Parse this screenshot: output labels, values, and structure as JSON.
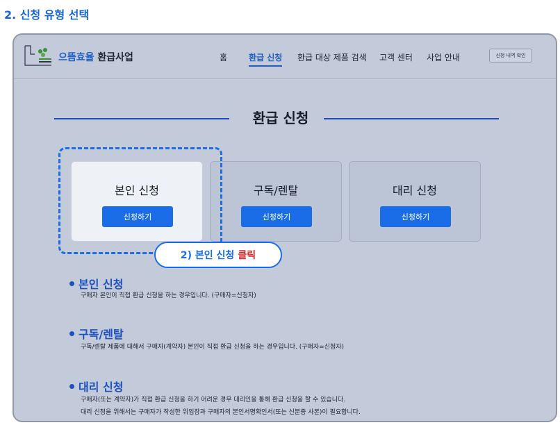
{
  "step_heading": "2. 신청 유형 선택",
  "header": {
    "brand_prefix": "으뜸효율",
    "brand_suffix": " 환급사업",
    "nav": [
      "홈",
      "환급 신청",
      "환급 대상 제품 검색",
      "고객 센터",
      "사업 안내"
    ],
    "active_nav": "환급 신청",
    "history_button": "신청 내역 확인"
  },
  "section_title": "환급 신청",
  "cards": [
    {
      "title": "본인 신청",
      "button": "신청하기"
    },
    {
      "title": "구독/렌탈",
      "button": "신청하기"
    },
    {
      "title": "대리 신청",
      "button": "신청하기"
    }
  ],
  "callout": {
    "text": "2) 본인 신청",
    "emphasis": "클릭"
  },
  "info": [
    {
      "heading": "본인 신청",
      "lines": [
        "구매자 본인이 직접 환급 신청을 하는 경우입니다. (구매자=신청자)"
      ]
    },
    {
      "heading": "구독/렌탈",
      "lines": [
        "구독/렌탈 제품에 대해서 구매자(계약자) 본인이 직접 환급 신청을 하는 경우입니다. (구매자=신청자)"
      ]
    },
    {
      "heading": "대리 신청",
      "lines": [
        "구매자(또는 계약자)가 직접 환급 신청을 하기 어려운 경우 대리인을 통해 환급 신청을 할 수 있습니다.",
        "대리 신청을 위해서는 구매자가 작성한 위임장과 구매자의 본인서명확인서(또는 신분증 사본)이 필요합니다."
      ]
    }
  ],
  "colors": {
    "accent": "#1a6ce8",
    "emphasis": "#e02323",
    "background": "#c3cad9"
  }
}
